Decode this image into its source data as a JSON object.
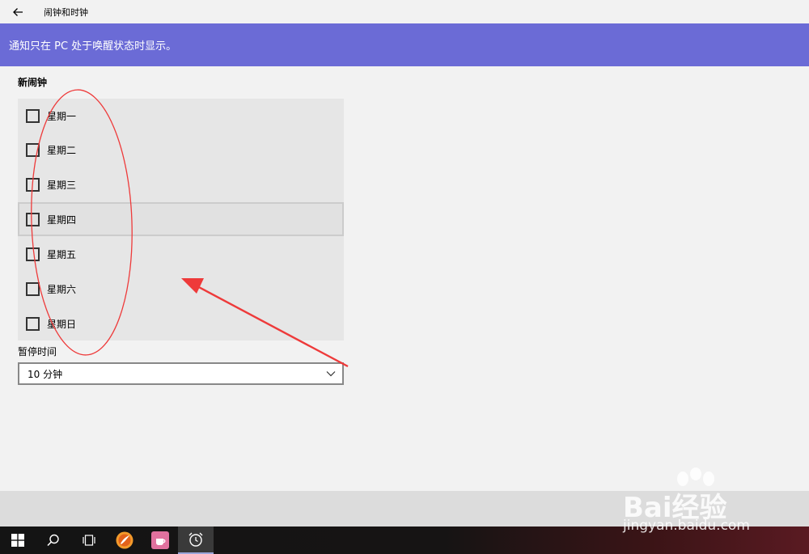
{
  "window": {
    "title": "闹钟和时钟",
    "back_icon": "back-arrow-icon"
  },
  "banner": {
    "text": "通知只在 PC 处于唤醒状态时显示。"
  },
  "alarm": {
    "section_title": "新闹钟",
    "days": [
      {
        "label": "星期一",
        "checked": false
      },
      {
        "label": "星期二",
        "checked": false
      },
      {
        "label": "星期三",
        "checked": false
      },
      {
        "label": "星期四",
        "checked": false
      },
      {
        "label": "星期五",
        "checked": false
      },
      {
        "label": "星期六",
        "checked": false
      },
      {
        "label": "星期日",
        "checked": false
      }
    ],
    "snooze_label": "暂停时间",
    "snooze_value": "10 分钟"
  },
  "taskbar": {
    "items": [
      "windows-start-icon",
      "search-icon",
      "task-view-icon",
      "app-orange-icon",
      "app-pink-icon",
      "alarm-clock-icon"
    ]
  },
  "colors": {
    "banner": "#6b6bd6",
    "annotation": "#ee3a3a"
  },
  "watermark": {
    "brand": "Bai经验",
    "url": "jingyan.baidu.com"
  }
}
